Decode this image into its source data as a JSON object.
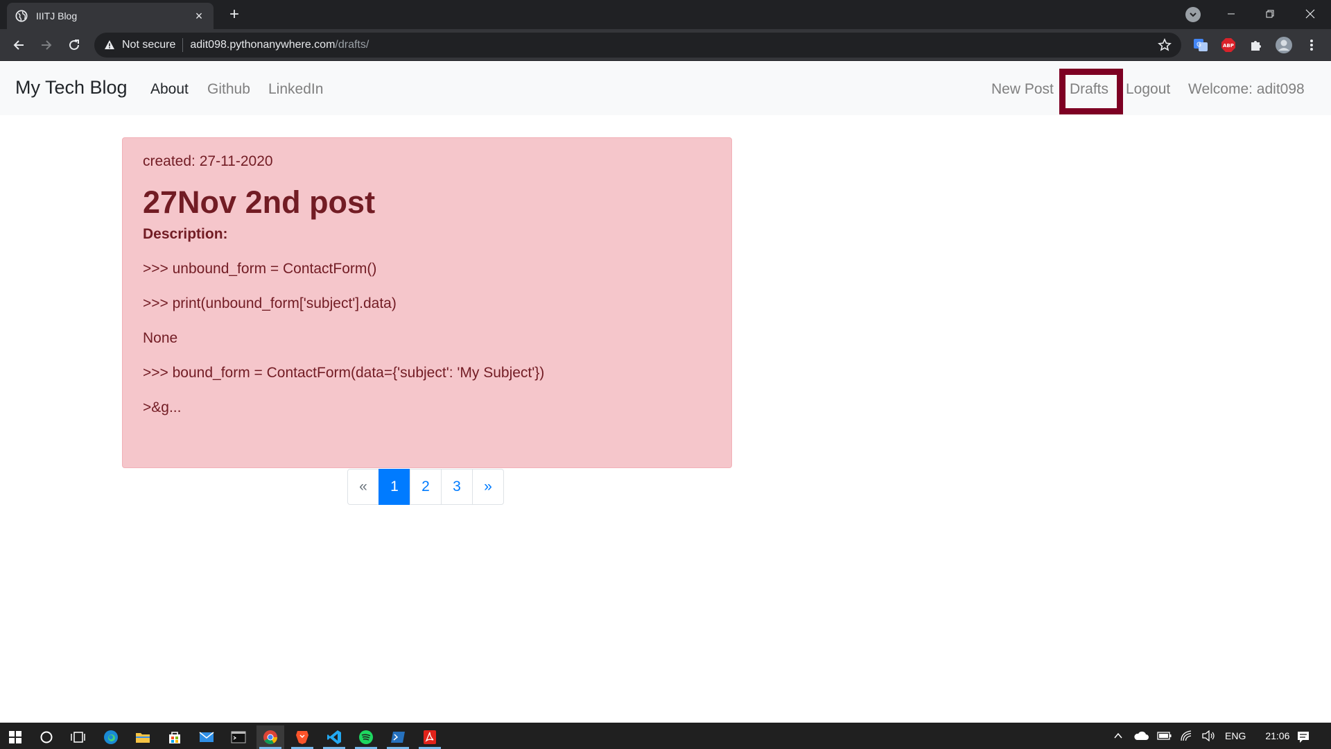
{
  "browser": {
    "tab_title": "IIITJ Blog",
    "security_label": "Not secure",
    "url_host": "adit098.pythonanywhere.com",
    "url_path": "/drafts/"
  },
  "site": {
    "brand": "My Tech Blog",
    "nav_left": [
      "About",
      "Github",
      "LinkedIn"
    ],
    "nav_right": [
      "New Post",
      "Drafts",
      "Logout",
      "Welcome: adit098"
    ]
  },
  "post": {
    "created": "created: 27-11-2020",
    "title": "27Nov 2nd post",
    "description_label": "Description:",
    "lines": [
      ">>> unbound_form = ContactForm()",
      ">>> print(unbound_form['subject'].data)",
      "None",
      ">>> bound_form = ContactForm(data={'subject': 'My Subject'})",
      ">&g..."
    ]
  },
  "pagination": {
    "prev": "«",
    "pages": [
      "1",
      "2",
      "3"
    ],
    "active_page": "1",
    "next": "»"
  },
  "taskbar": {
    "language": "ENG",
    "time": "21:06"
  },
  "colors": {
    "card_bg": "#f5c6cb",
    "card_text": "#721c24",
    "highlight_box": "#7d0023",
    "active_page": "#007bff"
  }
}
